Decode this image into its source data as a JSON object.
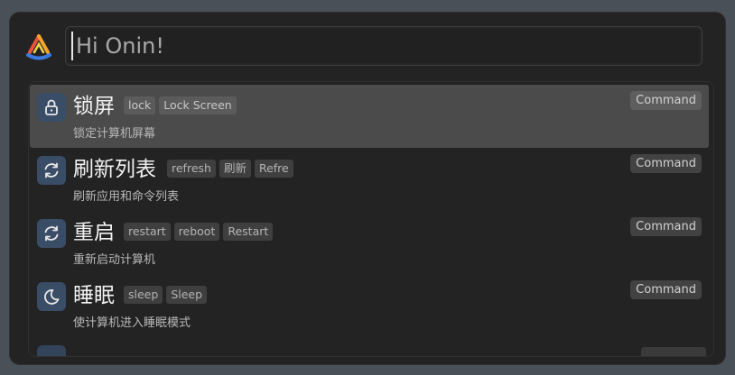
{
  "app": {
    "colors": {
      "accent_icon_bg": "#3a4d66",
      "selected_row_bg": "#4b4b4b",
      "window_bg": "#232323"
    }
  },
  "search": {
    "placeholder": "Hi Onin!",
    "value": ""
  },
  "logo": {
    "icon": "app-logo-triangle-icon"
  },
  "results": [
    {
      "title": "锁屏",
      "tags": [
        "lock",
        "Lock Screen"
      ],
      "description": "锁定计算机屏幕",
      "badge": "Command",
      "icon": "lock-icon",
      "selected": true
    },
    {
      "title": "刷新列表",
      "tags": [
        "refresh",
        "刷新",
        "Refre"
      ],
      "description": "刷新应用和命令列表",
      "badge": "Command",
      "icon": "refresh-icon",
      "selected": false
    },
    {
      "title": "重启",
      "tags": [
        "restart",
        "reboot",
        "Restart"
      ],
      "description": "重新启动计算机",
      "badge": "Command",
      "icon": "refresh-icon",
      "selected": false
    },
    {
      "title": "睡眠",
      "tags": [
        "sleep",
        "Sleep"
      ],
      "description": "使计算机进入睡眠模式",
      "badge": "Command",
      "icon": "moon-icon",
      "selected": false
    }
  ]
}
